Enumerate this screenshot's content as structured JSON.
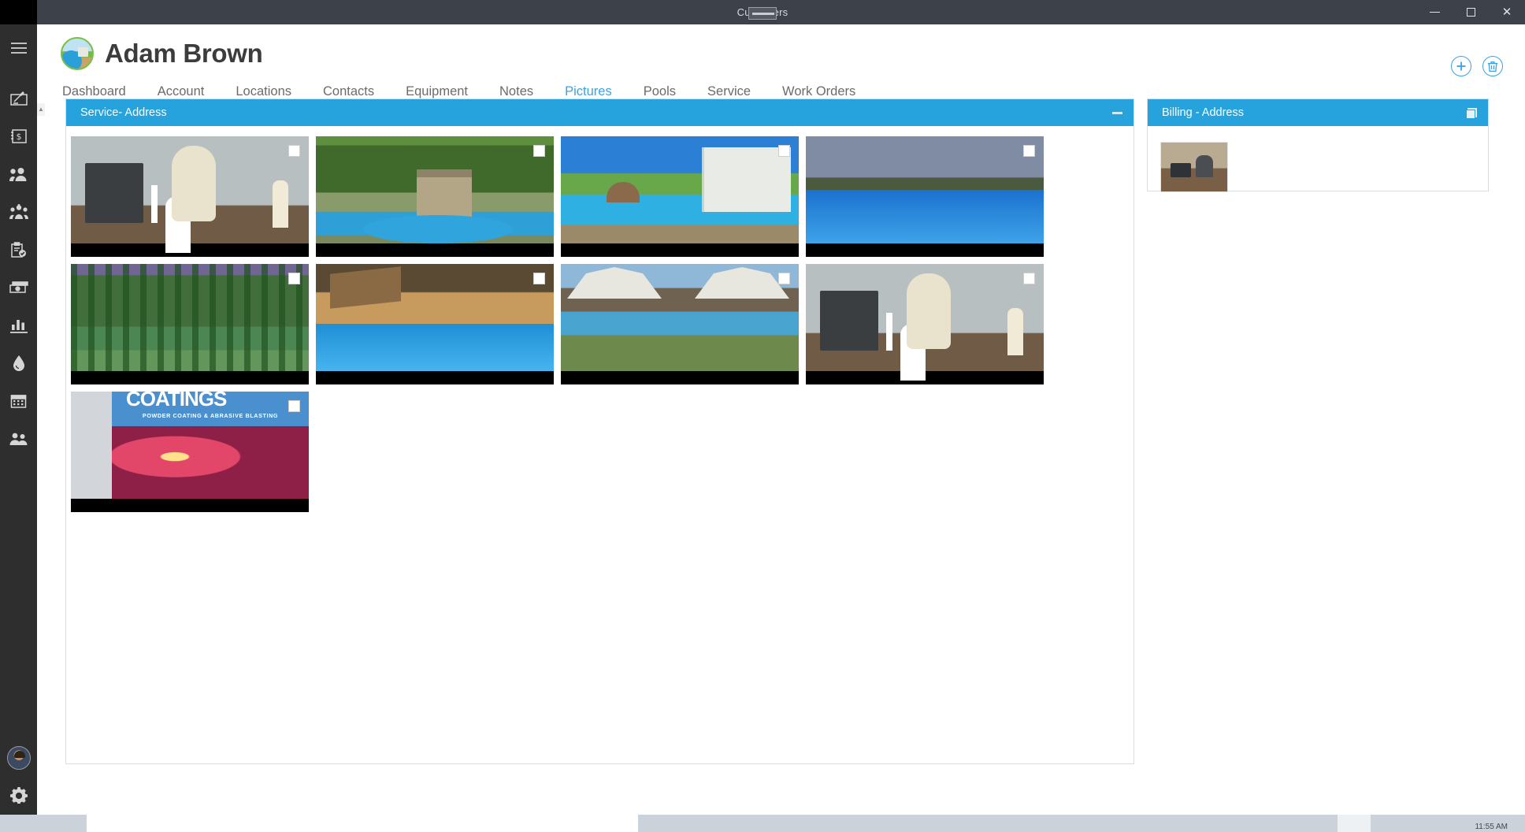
{
  "window": {
    "title": "Customers",
    "title_redacted": true,
    "controls": {
      "minimize": "minimize-icon",
      "restore": "restore-icon",
      "close": "close-icon"
    }
  },
  "sidebar": {
    "menu_label": "hamburger-menu-icon",
    "items": [
      {
        "name": "sidebar-item-estimates",
        "icon": "signature-pad-icon"
      },
      {
        "name": "sidebar-item-invoices",
        "icon": "invoice-dollar-icon"
      },
      {
        "name": "sidebar-item-leads",
        "icon": "user-search-icon"
      },
      {
        "name": "sidebar-item-customers",
        "icon": "people-group-icon"
      },
      {
        "name": "sidebar-item-work-orders",
        "icon": "clipboard-check-icon"
      },
      {
        "name": "sidebar-item-payments",
        "icon": "cash-icon"
      },
      {
        "name": "sidebar-item-reports",
        "icon": "bar-chart-icon"
      },
      {
        "name": "sidebar-item-chemicals",
        "icon": "water-drop-icon"
      },
      {
        "name": "sidebar-item-schedule",
        "icon": "calendar-icon"
      },
      {
        "name": "sidebar-item-employees",
        "icon": "two-users-icon"
      }
    ],
    "account_avatar": "user-avatar",
    "settings": "gear-icon"
  },
  "header": {
    "customer_name": "Adam Brown",
    "logo": "pool-company-logo",
    "actions": [
      {
        "name": "add-button",
        "icon": "plus-icon",
        "color": "#3da0e3"
      },
      {
        "name": "delete-button",
        "icon": "trash-icon",
        "color": "#3da0e3"
      }
    ]
  },
  "tabs": {
    "active": "Pictures",
    "items": [
      "Dashboard",
      "Account",
      "Locations",
      "Contacts",
      "Equipment",
      "Notes",
      "Pictures",
      "Pools",
      "Service",
      "Work Orders"
    ]
  },
  "panels": {
    "service": {
      "title": "Service- Address",
      "collapse_label": "collapse-icon",
      "pictures": [
        {
          "alt": "pool-equipment-heater-filter",
          "scene": "sc-equip1",
          "checked": false
        },
        {
          "alt": "backyard-shed-above-ground-pool",
          "scene": "sc-yard",
          "checked": false
        },
        {
          "alt": "tropical-backyard-pool-with-house",
          "scene": "sc-pool1",
          "checked": false
        },
        {
          "alt": "large-rectangular-pool-at-dusk",
          "scene": "sc-pool2",
          "checked": false
        },
        {
          "alt": "palm-tree-lined-resort-pool",
          "scene": "sc-palms",
          "checked": false
        },
        {
          "alt": "wood-deck-pool-with-waterfall",
          "scene": "sc-deck",
          "checked": false
        },
        {
          "alt": "garden-pool-with-flowers-and-houses",
          "scene": "sc-garden",
          "checked": false
        },
        {
          "alt": "pool-equipment-pad-second-view",
          "scene": "sc-equip1",
          "checked": false
        },
        {
          "alt": "coatings-powder-coating-banner",
          "scene": "sc-coating",
          "checked": false
        }
      ],
      "banner_overlay": {
        "logo_text": "COATINGS",
        "tagline": "POWDER COATING & ABRASIVE BLASTING"
      }
    },
    "billing": {
      "title": "Billing - Address",
      "restore_label": "restore-icon",
      "pictures": [
        {
          "alt": "pump-and-filter-on-pad",
          "scene": "sc-billing",
          "checked": false
        }
      ]
    }
  },
  "taskbar": {
    "clock": "11:55 AM"
  },
  "colors": {
    "panel_header": "#26a3dd",
    "accent": "#3da0e3",
    "sidebar_bg": "#2e2e2e",
    "titlebar_bg": "#3d4149"
  }
}
